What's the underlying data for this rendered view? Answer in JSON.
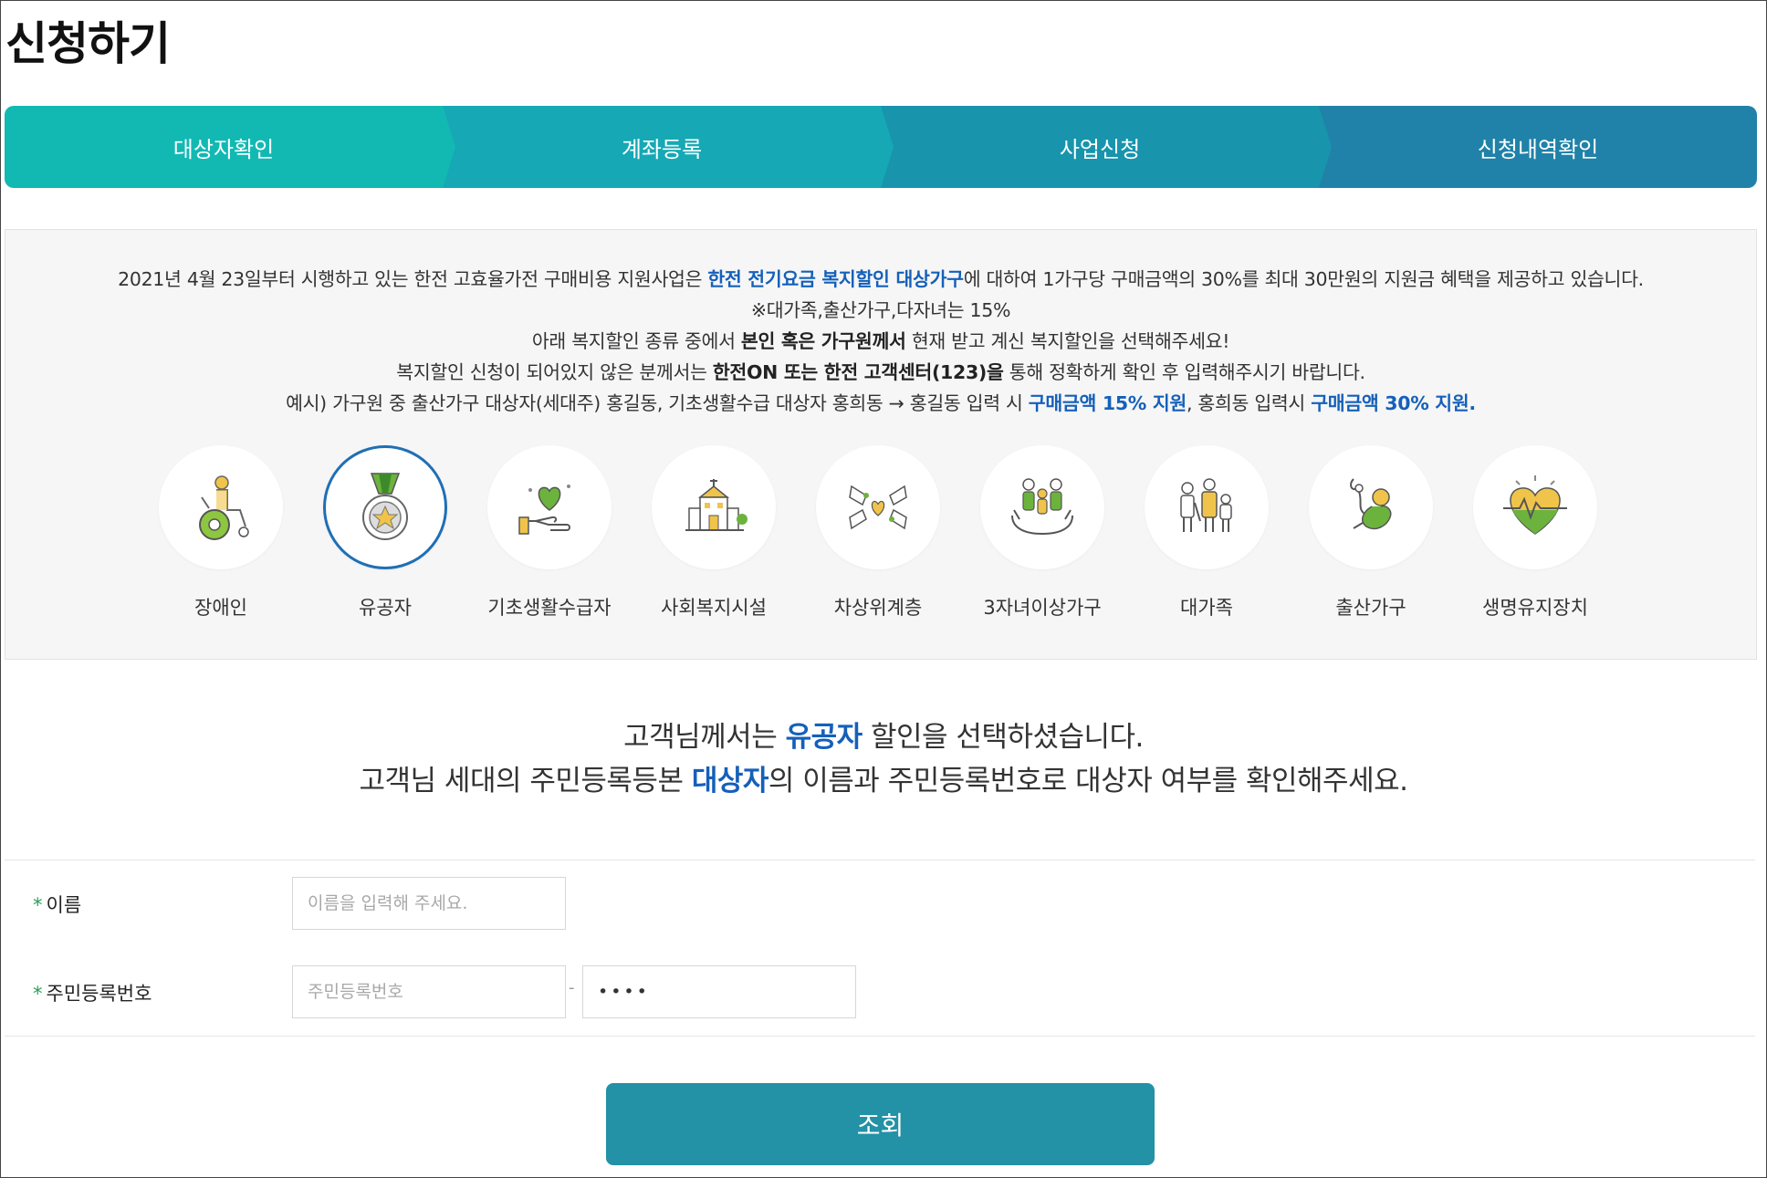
{
  "page": {
    "title": "신청하기"
  },
  "steps": [
    {
      "label": "대상자확인"
    },
    {
      "label": "계좌등록"
    },
    {
      "label": "사업신청"
    },
    {
      "label": "신청내역확인"
    }
  ],
  "info": {
    "line1_a": "2021년 4월 23일부터 시행하고 있는 한전 고효율가전 구매비용 지원사업은 ",
    "line1_hl": "한전 전기요금 복지할인 대상가구",
    "line1_b": "에 대하여 1가구당 구매금액의 30%를 최대 30만원의 지원금 혜택을 제공하고 있습니다.",
    "line2": "※대가족,출산가구,다자녀는 15%",
    "line3_a": "아래 복지할인 종류 중에서 ",
    "line3_bold": "본인 혹은 가구원께서",
    "line3_b": " 현재 받고 계신 복지할인을 선택해주세요!",
    "line4_a": "복지할인 신청이 되어있지 않은 분께서는 ",
    "line4_bold": "한전ON 또는 한전 고객센터(123)을",
    "line4_b": " 통해 정확하게 확인 후 입력해주시기 바랍니다.",
    "line5_a": "예시) 가구원 중 출산가구 대상자(세대주) 홍길동, 기초생활수급 대상자 홍희동 → 홍길동 입력 시 ",
    "line5_hl1": "구매금액 15% 지원",
    "line5_b": ", 홍희동 입력시 ",
    "line5_hl2": "구매금액 30% 지원."
  },
  "categories": [
    {
      "label": "장애인",
      "icon": "wheelchair-icon"
    },
    {
      "label": "유공자",
      "icon": "medal-icon",
      "selected": true
    },
    {
      "label": "기초생활수급자",
      "icon": "heart-hand-icon"
    },
    {
      "label": "사회복지시설",
      "icon": "building-icon"
    },
    {
      "label": "차상위계층",
      "icon": "hands-icon"
    },
    {
      "label": "3자녀이상가구",
      "icon": "family-icon"
    },
    {
      "label": "대가족",
      "icon": "big-family-icon"
    },
    {
      "label": "출산가구",
      "icon": "baby-icon"
    },
    {
      "label": "생명유지장치",
      "icon": "heartbeat-icon"
    }
  ],
  "notice": {
    "line1_a": "고객님께서는 ",
    "line1_hl": "유공자",
    "line1_b": " 할인을 선택하셨습니다.",
    "line2_a": "고객님 세대의 주민등록등본 ",
    "line2_hl": "대상자",
    "line2_b": "의 이름과 주민등록번호로 대상자 여부를 확인해주세요."
  },
  "form": {
    "required_mark": "*",
    "name_label": "이름",
    "name_placeholder": "이름을 입력해 주세요.",
    "rrn_label": "주민등록번호",
    "rrn_placeholder": "주민등록번호",
    "rrn_separator": "-",
    "rrn_back_value": "••••",
    "submit_label": "조회"
  },
  "colors": {
    "accent_blue": "#1560b9",
    "step1": "#12b9b3",
    "step4": "#2082a8",
    "button": "#2391a6"
  }
}
